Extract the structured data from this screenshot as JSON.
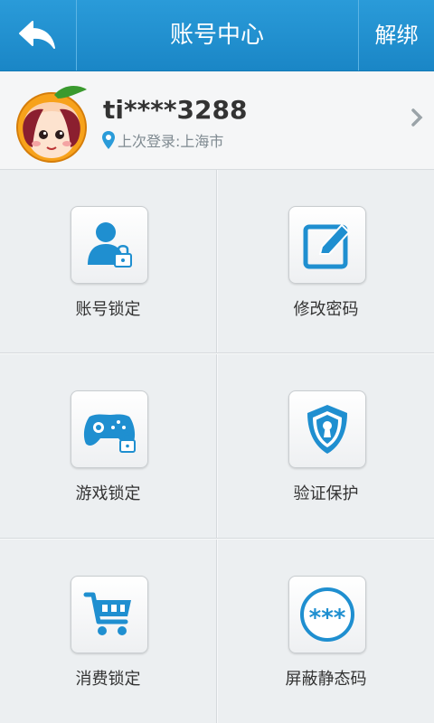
{
  "header": {
    "title": "账号中心",
    "unbind_label": "解绑"
  },
  "account": {
    "username": "ti****3288",
    "last_login": "上次登录:上海市"
  },
  "grid": [
    {
      "label": "账号锁定",
      "icon": "user-lock-icon"
    },
    {
      "label": "修改密码",
      "icon": "edit-icon"
    },
    {
      "label": "游戏锁定",
      "icon": "gamepad-lock-icon"
    },
    {
      "label": "验证保护",
      "icon": "shield-keyhole-icon"
    },
    {
      "label": "消费锁定",
      "icon": "shopping-cart-icon"
    },
    {
      "label": "屏蔽静态码",
      "icon": "password-dots-icon"
    }
  ],
  "colors": {
    "accent": "#1a86c6",
    "icon_blue": "#1f8fd0"
  }
}
